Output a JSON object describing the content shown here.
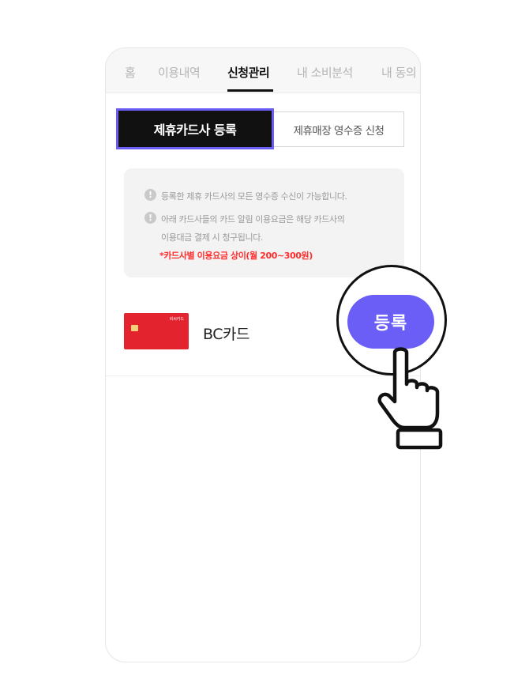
{
  "tabs": [
    {
      "label": "홈"
    },
    {
      "label": "이용내역"
    },
    {
      "label": "신청관리"
    },
    {
      "label": "내 소비분석"
    },
    {
      "label": "내 동의"
    }
  ],
  "active_tab": "신청관리",
  "segments": {
    "active_label": "제휴카드사 등록",
    "inactive_label": "제휴매장 영수증 신청"
  },
  "notice": {
    "line1": "등록한 제휴 카드사의 모든 영수증 수신이 가능합니다.",
    "line2a": "아래 카드사들의 카드 알림 이용요금은 해당 카드사의",
    "line2b": "이용대금 결제 시 청구됩니다.",
    "fee_note": "*카드사별 이용요금 상이(월 200~300원)",
    "icon": "exclamation-icon"
  },
  "card": {
    "name": "BC카드",
    "logo_text": "비씨카드"
  },
  "register_button": {
    "label": "등록"
  },
  "colors": {
    "accent": "#6a5ef6",
    "card_red": "#e3242e",
    "fee_red": "#ff2d2d"
  }
}
